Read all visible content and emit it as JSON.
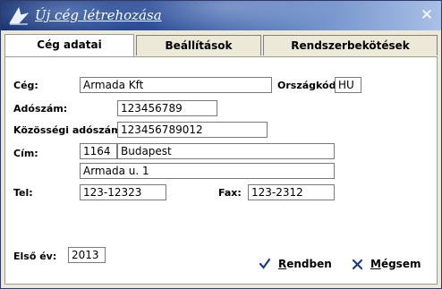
{
  "window": {
    "title": "Új cég létrehozása"
  },
  "tabs": [
    {
      "label": "Cég adatai",
      "active": true
    },
    {
      "label": "Beállítások",
      "active": false
    },
    {
      "label": "Rendszerbekötések",
      "active": false
    }
  ],
  "form": {
    "ceg_label": "Cég:",
    "ceg_value": "Armada Kft",
    "orszagkod_label": "Országkód",
    "orszagkod_value": "HU",
    "adoszam_label": "Adószám:",
    "adoszam_value": "123456789",
    "kozossegi_label": "Közösségi adószám:",
    "kozossegi_value": "123456789012",
    "cim_label": "Cím:",
    "zip_value": "1164",
    "city_value": "Budapest",
    "street_value": "Armada u. 1",
    "tel_label": "Tel:",
    "tel_value": "123-12323",
    "fax_label": "Fax:",
    "fax_value": "123-2312",
    "elso_ev_label": "Első év:",
    "elso_ev_value": "2013"
  },
  "buttons": {
    "ok_first": "R",
    "ok_rest": "endben",
    "cancel_first": "M",
    "cancel_rest": "égsem"
  },
  "colors": {
    "title_dark": "#16306e",
    "ok_icon": "#1e3a8a",
    "cancel_icon": "#1e3a8a"
  }
}
